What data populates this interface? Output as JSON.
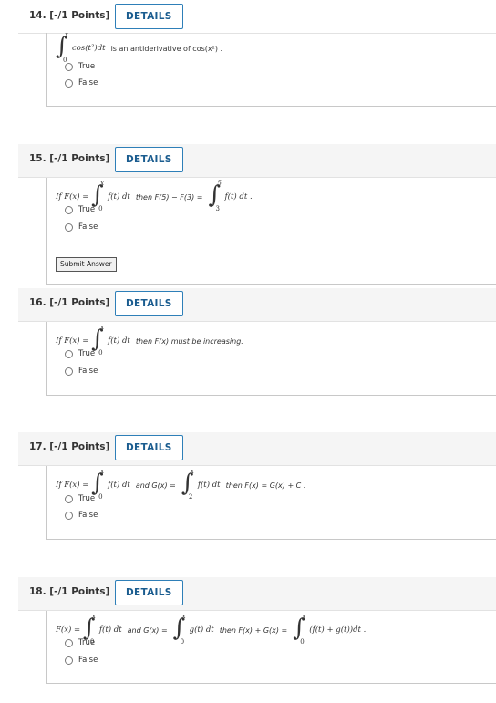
{
  "questions": [
    {
      "number": "14.",
      "points": "[-/1 Points]",
      "details_label": "DETAILS",
      "true_label": "True",
      "false_label": "False"
    },
    {
      "number": "15.",
      "points": "[-/1 Points]",
      "details_label": "DETAILS",
      "true_label": "True",
      "false_label": "False",
      "submit_label": "Submit Answer"
    },
    {
      "number": "16.",
      "points": "[-/1 Points]",
      "details_label": "DETAILS",
      "true_label": "True",
      "false_label": "False"
    },
    {
      "number": "17.",
      "points": "[-/1 Points]",
      "details_label": "DETAILS",
      "true_label": "True",
      "false_label": "False"
    },
    {
      "number": "18.",
      "points": "[-/1 Points]",
      "details_label": "DETAILS",
      "true_label": "True",
      "false_label": "False"
    }
  ],
  "q14": {
    "integrand": "cos(t²)dt",
    "text": "is an antiderivative of cos(x²) ."
  },
  "q15": {
    "if": "If  F(x) =",
    "integrand1": "f(t)  dt",
    "then": "then  F(5) − F(3) =",
    "integrand2": "f(t)  dt ."
  },
  "q16": {
    "if": "If  F(x) =",
    "integrand": "f(t)  dt",
    "then": "then  F(x)  must be increasing."
  },
  "q17": {
    "if": "If  F(x) =",
    "integrand1": "f(t)  dt",
    "and": "and  G(x) =",
    "integrand2": "f(t)  dt",
    "then": "then  F(x) = G(x) + C ."
  },
  "q18": {
    "lhs": "F(x) =",
    "integrand1": "f(t)  dt",
    "and": "and  G(x) =",
    "integrand2": "g(t)  dt",
    "then": "then  F(x) + G(x) =",
    "integrand3": "(f(t) + g(t))dt ."
  },
  "limits": {
    "x": "x",
    "zero": "0",
    "five": "5",
    "three": "3",
    "two": "2"
  }
}
